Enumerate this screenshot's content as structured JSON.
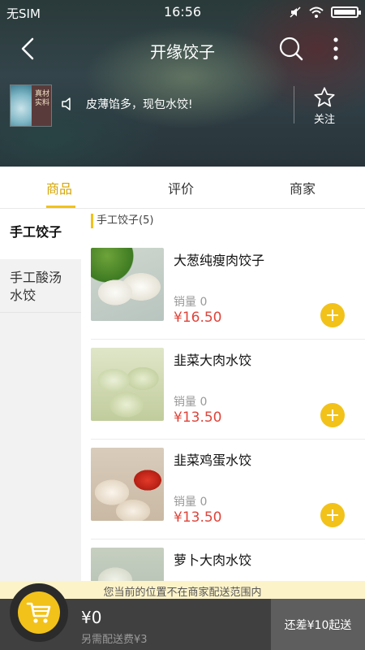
{
  "status_bar": {
    "carrier": "无SIM",
    "time": "16:56"
  },
  "nav": {
    "title": "开缘饺子"
  },
  "shop": {
    "logo_text": "真材实料",
    "notice": "皮薄馅多，现包水饺!",
    "follow_label": "关注"
  },
  "tabs": [
    {
      "label": "商品",
      "active": true
    },
    {
      "label": "评价",
      "active": false
    },
    {
      "label": "商家",
      "active": false
    }
  ],
  "categories": [
    {
      "label": "手工饺子",
      "active": true
    },
    {
      "label": "手工酸汤水饺",
      "active": false
    }
  ],
  "section": {
    "title": "手工饺子(5)"
  },
  "products": [
    {
      "name": "大葱纯瘦肉饺子",
      "sales": "销量 0",
      "price": "¥16.50"
    },
    {
      "name": "韭菜大肉水饺",
      "sales": "销量 0",
      "price": "¥13.50"
    },
    {
      "name": "韭菜鸡蛋水饺",
      "sales": "销量 0",
      "price": "¥13.50"
    },
    {
      "name": "萝卜大肉水饺",
      "sales": "",
      "price": ""
    }
  ],
  "cart": {
    "warning": "您当前的位置不在商家配送范围内",
    "total": "¥0",
    "delivery_fee": "另需配送费¥3",
    "checkout_label": "还差¥10起送"
  },
  "colors": {
    "accent": "#f2c21a",
    "price": "#e0443a",
    "cart_bar": "#404040"
  }
}
